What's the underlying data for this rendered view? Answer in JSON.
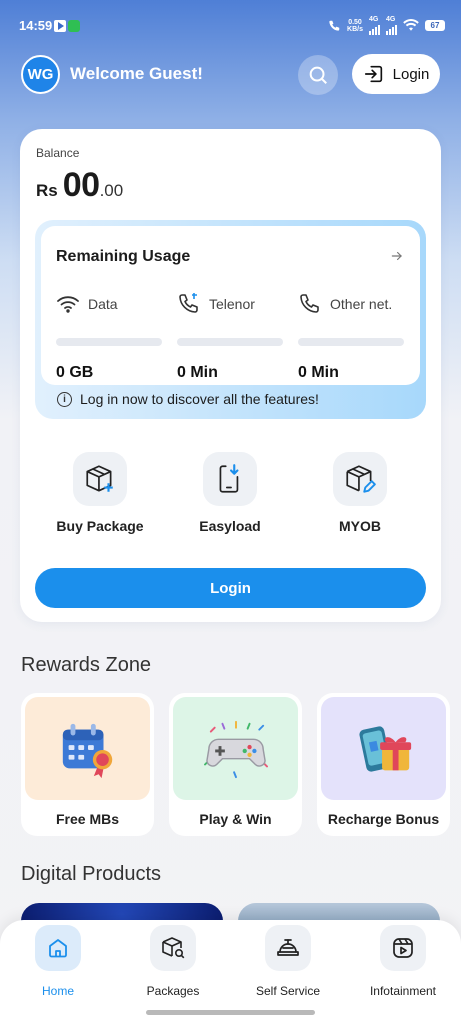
{
  "status_bar": {
    "time": "14:59",
    "net_speed_value": "0.50",
    "net_speed_unit": "KB/s",
    "sim1_label": "4G",
    "sim2_label": "4G",
    "battery": "67"
  },
  "header": {
    "avatar_initials": "WG",
    "welcome_text": "Welcome Guest!",
    "search_icon": "search-icon",
    "login_label": "Login",
    "login_icon": "sign-in-icon"
  },
  "balance": {
    "label": "Balance",
    "currency": "Rs",
    "amount": "00",
    "decimals": ".00"
  },
  "usage": {
    "title": "Remaining Usage",
    "items": [
      {
        "label": "Data",
        "icon": "wifi-icon",
        "value": "0 GB"
      },
      {
        "label": "Telenor",
        "icon": "phone-icon",
        "value": "0 Min"
      },
      {
        "label": "Other net.",
        "icon": "phone-icon",
        "value": "0 Min"
      }
    ],
    "info_text": "Log in now to discover all the features!"
  },
  "quick_actions": [
    {
      "label": "Buy Package",
      "icon": "package-add-icon"
    },
    {
      "label": "Easyload",
      "icon": "phone-download-icon"
    },
    {
      "label": "MYOB",
      "icon": "package-edit-icon"
    }
  ],
  "main_login_label": "Login",
  "rewards": {
    "title": "Rewards Zone",
    "items": [
      {
        "label": "Free MBs",
        "icon": "calendar-badge-icon",
        "bg": "#fdebd8"
      },
      {
        "label": "Play & Win",
        "icon": "gamepad-icon",
        "bg": "#ddf5e7"
      },
      {
        "label": "Recharge Bonus",
        "icon": "gift-phone-icon",
        "bg": "#e4e2fb"
      }
    ]
  },
  "digital_products_title": "Digital Products",
  "nav": {
    "items": [
      {
        "label": "Home",
        "icon": "home-icon",
        "active": true
      },
      {
        "label": "Packages",
        "icon": "package-search-icon",
        "active": false
      },
      {
        "label": "Self Service",
        "icon": "service-bell-icon",
        "active": false
      },
      {
        "label": "Infotainment",
        "icon": "play-icon",
        "active": false
      }
    ]
  },
  "colors": {
    "accent": "#1b8fec",
    "header_blue": "#4f7fd6"
  }
}
